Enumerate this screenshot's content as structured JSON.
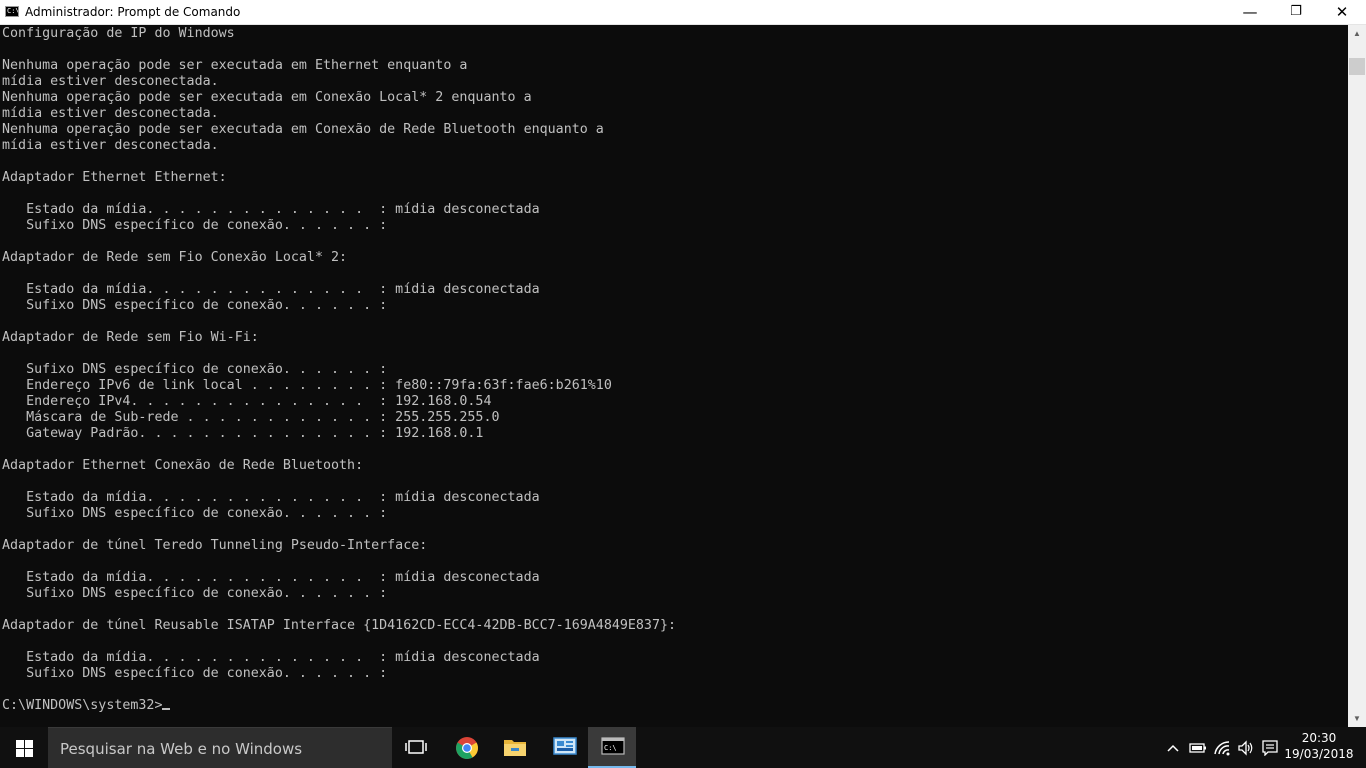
{
  "window": {
    "title": "Administrador: Prompt de Comando",
    "buttons": {
      "minimize": "—",
      "maximize": "❐",
      "close": "✕"
    }
  },
  "console": {
    "lines": [
      "Configuração de IP do Windows",
      "",
      "Nenhuma operação pode ser executada em Ethernet enquanto a",
      "mídia estiver desconectada.",
      "Nenhuma operação pode ser executada em Conexão Local* 2 enquanto a",
      "mídia estiver desconectada.",
      "Nenhuma operação pode ser executada em Conexão de Rede Bluetooth enquanto a",
      "mídia estiver desconectada.",
      "",
      "Adaptador Ethernet Ethernet:",
      "",
      "   Estado da mídia. . . . . . . . . . . . . .  : mídia desconectada",
      "   Sufixo DNS específico de conexão. . . . . . :",
      "",
      "Adaptador de Rede sem Fio Conexão Local* 2:",
      "",
      "   Estado da mídia. . . . . . . . . . . . . .  : mídia desconectada",
      "   Sufixo DNS específico de conexão. . . . . . :",
      "",
      "Adaptador de Rede sem Fio Wi-Fi:",
      "",
      "   Sufixo DNS específico de conexão. . . . . . :",
      "   Endereço IPv6 de link local . . . . . . . . : fe80::79fa:63f:fae6:b261%10",
      "   Endereço IPv4. . . . . . . . . . . . . . .  : 192.168.0.54",
      "   Máscara de Sub-rede . . . . . . . . . . . . : 255.255.255.0",
      "   Gateway Padrão. . . . . . . . . . . . . . . : 192.168.0.1",
      "",
      "Adaptador Ethernet Conexão de Rede Bluetooth:",
      "",
      "   Estado da mídia. . . . . . . . . . . . . .  : mídia desconectada",
      "   Sufixo DNS específico de conexão. . . . . . :",
      "",
      "Adaptador de túnel Teredo Tunneling Pseudo-Interface:",
      "",
      "   Estado da mídia. . . . . . . . . . . . . .  : mídia desconectada",
      "   Sufixo DNS específico de conexão. . . . . . :",
      "",
      "Adaptador de túnel Reusable ISATAP Interface {1D4162CD-ECC4-42DB-BCC7-169A4849E837}:",
      "",
      "   Estado da mídia. . . . . . . . . . . . . .  : mídia desconectada",
      "   Sufixo DNS específico de conexão. . . . . . :",
      "",
      "C:\\WINDOWS\\system32>"
    ]
  },
  "taskbar": {
    "search_placeholder": "Pesquisar na Web e no Windows",
    "apps": [
      {
        "name": "task-view-icon"
      },
      {
        "name": "chrome-icon"
      },
      {
        "name": "file-explorer-icon"
      },
      {
        "name": "control-panel-icon"
      },
      {
        "name": "command-prompt-icon",
        "active": true
      }
    ],
    "tray": {
      "time": "20:30",
      "date": "19/03/2018"
    }
  },
  "colors": {
    "console_bg": "#0c0c0c",
    "console_text": "#c0c0c0",
    "taskbar_bg": "#101010",
    "active_indicator": "#76b9ed"
  }
}
